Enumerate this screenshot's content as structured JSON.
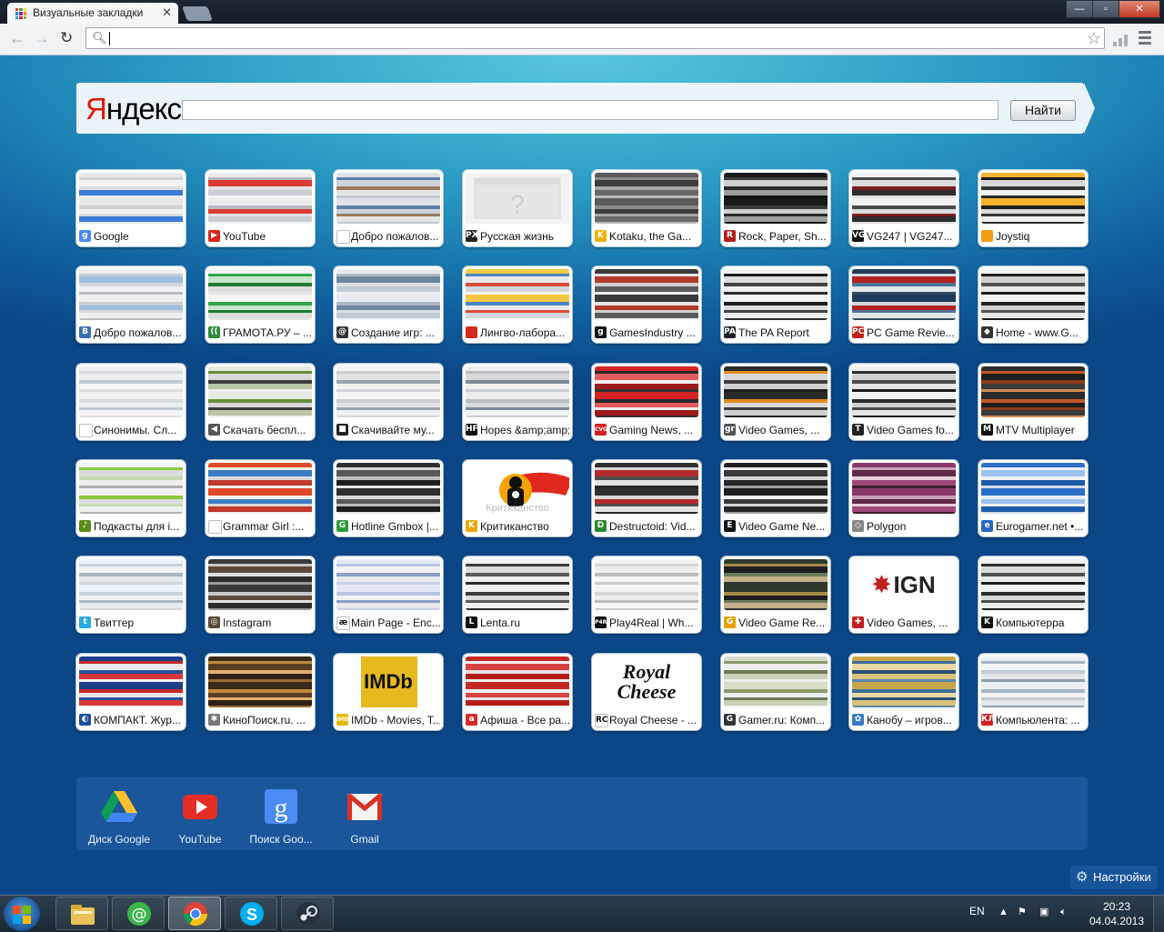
{
  "browser": {
    "tab_title": "Визуальные закладки",
    "tab_close": "✕",
    "window_controls": {
      "minimize": "—",
      "maximize": "▫",
      "close": "✕"
    },
    "address_value": ""
  },
  "yandex": {
    "logo_first": "Я",
    "logo_rest": "ндекс",
    "search_value": "",
    "search_button": "Найти"
  },
  "bookmarks": [
    {
      "label": "Google",
      "fav": "g",
      "fav_color": "#4a8af4",
      "stripes": [
        "#e8e8e8",
        "#cfd3d8",
        "#f2f2f2",
        "#dadde1",
        "#3a7bd5",
        "#e9ebee"
      ]
    },
    {
      "label": "YouTube",
      "fav": "▶",
      "fav_color": "#d8261d",
      "stripes": [
        "#ececec",
        "#b4b9bf",
        "#d93c34",
        "#e3e3e3",
        "#c9cdd2",
        "#f2f2f2"
      ]
    },
    {
      "label": "Добро пожалов...",
      "fav": "",
      "fav_color": "#ffffff",
      "stripes": [
        "#dfe3e7",
        "#5e7fa8",
        "#cdd3da",
        "#9a7a60",
        "#e5e5e5",
        "#c2c8cf"
      ]
    },
    {
      "label": "Русская жизнь",
      "fav": "РЖ",
      "fav_color": "#222222",
      "placeholder": true,
      "stripes": [
        "#f0f0f0",
        "#f0f0f0"
      ]
    },
    {
      "label": "Kotaku, the Ga...",
      "fav": "K",
      "fav_color": "#f0b400",
      "stripes": [
        "#5b5b5b",
        "#8a8a8a",
        "#3d3d3d",
        "#a5a5a5",
        "#696969",
        "#b8b8b8"
      ]
    },
    {
      "label": "Rock, Paper, Sh...",
      "fav": "R",
      "fav_color": "#b02020",
      "stripes": [
        "#1a1a1a",
        "#3b3b3b",
        "#d0d0d0",
        "#2a2a2a",
        "#9e9e9e",
        "#111111"
      ]
    },
    {
      "label": "VG247 | VG247...",
      "fav": "VG",
      "fav_color": "#111111",
      "stripes": [
        "#f1f1f1",
        "#4a4a4a",
        "#dcdcdc",
        "#7a2020",
        "#2d2d2d",
        "#e0e0e0"
      ]
    },
    {
      "label": "Joystiq",
      "fav": "",
      "fav_color": "#f39c12",
      "stripes": [
        "#f2b22d",
        "#1c1c1c",
        "#d9d9d9",
        "#333333",
        "#f0f0f0",
        "#2a2a2a"
      ]
    },
    {
      "label": "Добро пожалов...",
      "fav": "B",
      "fav_color": "#3b6fb0",
      "stripes": [
        "#eeeeee",
        "#c8cdd2",
        "#9cc0e0",
        "#d5d8dc",
        "#efefef",
        "#b7bcc2"
      ]
    },
    {
      "label": "ГРАМОТА.РУ – ...",
      "fav": "((",
      "fav_color": "#2d8a3a",
      "stripes": [
        "#f3f3f3",
        "#2fa449",
        "#c8e6c9",
        "#1f7a34",
        "#dcdcdc",
        "#e6e6e6"
      ]
    },
    {
      "label": "Создание игр: ...",
      "fav": "@",
      "fav_color": "#333333",
      "stripes": [
        "#e7ebef",
        "#aeb8c2",
        "#6f879e",
        "#d8dde2",
        "#c1cad3",
        "#eef0f2"
      ]
    },
    {
      "label": "Лингво-лабора...",
      "fav": "",
      "fav_color": "#d52b1e",
      "stripes": [
        "#f5c842",
        "#4a86c7",
        "#e9e9e9",
        "#d84a3a",
        "#cfd6dc",
        "#f3f3f3"
      ]
    },
    {
      "label": "GamesIndustry ...",
      "fav": "g",
      "fav_color": "#111111",
      "stripes": [
        "#3a3a3a",
        "#e5e5e5",
        "#b23a2a",
        "#cfcfcf",
        "#5a5a5a",
        "#efefef"
      ]
    },
    {
      "label": "The PA Report",
      "fav": "PA",
      "fav_color": "#222222",
      "stripes": [
        "#f2f2f2",
        "#1e1e1e",
        "#dcdcdc",
        "#444444",
        "#eeeeee",
        "#2b2b2b"
      ]
    },
    {
      "label": "PC Game Revie...",
      "fav": "PC",
      "fav_color": "#c0201a",
      "stripes": [
        "#1f3c5a",
        "#d3d9df",
        "#b42222",
        "#4e7399",
        "#e4e7ea",
        "#31485e"
      ]
    },
    {
      "label": "Home - www.G...",
      "fav": "◆",
      "fav_color": "#333333",
      "stripes": [
        "#f2f2f2",
        "#222222",
        "#cfcfcf",
        "#505050",
        "#e8e8e8",
        "#1a1a1a"
      ]
    },
    {
      "label": "Синонимы. Сл...",
      "fav": "",
      "fav_color": "#ffffff",
      "stripes": [
        "#f1f1f1",
        "#d6dbe0",
        "#eeeeee",
        "#c3cad1",
        "#f5f5f5",
        "#dedede"
      ]
    },
    {
      "label": "Скачать беспл...",
      "fav": "◀",
      "fav_color": "#555555",
      "stripes": [
        "#e6eadf",
        "#6b8c3a",
        "#d8d8d8",
        "#3c3c3c",
        "#b9c5a6",
        "#efefef"
      ]
    },
    {
      "label": "Скачивайте му...",
      "fav": "■",
      "fav_color": "#222222",
      "stripes": [
        "#f3f3f3",
        "#c9ced3",
        "#e2e2e2",
        "#9aa3ab",
        "#f0f0f0",
        "#d2d6da"
      ]
    },
    {
      "label": "Hopes &amp;amp; F...",
      "fav": "HF",
      "fav_color": "#111111",
      "stripes": [
        "#ececec",
        "#b8bec4",
        "#d9d9d9",
        "#7f8a95",
        "#f1f1f1",
        "#c9ced3"
      ]
    },
    {
      "label": "Gaming News, ...",
      "fav": "CVG",
      "fav_color": "#d81f1f",
      "stripes": [
        "#d42121",
        "#2a2a2a",
        "#e35b5b",
        "#f0f0f0",
        "#9e1a1a",
        "#333333"
      ]
    },
    {
      "label": "Video Games, ...",
      "fav": "gr",
      "fav_color": "#555555",
      "stripes": [
        "#2b2b2b",
        "#e08a1e",
        "#d8d8d8",
        "#3e3e3e",
        "#cfcfcf",
        "#1f1f1f"
      ]
    },
    {
      "label": "Video Games fo...",
      "fav": "T",
      "fav_color": "#222222",
      "stripes": [
        "#f2f2f2",
        "#2d2d2d",
        "#d0d0d0",
        "#4a4a4a",
        "#e4e4e4",
        "#1c1c1c"
      ]
    },
    {
      "label": "MTV Multiplayer",
      "fav": "M",
      "fav_color": "#111111",
      "stripes": [
        "#2a2a2a",
        "#c0562a",
        "#1e1e1e",
        "#8c3b1c",
        "#3b3b3b",
        "#d28b52"
      ]
    },
    {
      "label": "Подкасты для i...",
      "fav": "♪",
      "fav_color": "#5b8c1a",
      "stripes": [
        "#f2f2f2",
        "#8dc63f",
        "#dcdcdc",
        "#c9d8b3",
        "#efefef",
        "#b0b0b0"
      ]
    },
    {
      "label": "Grammar Girl :...",
      "fav": "",
      "fav_color": "#ffffff",
      "stripes": [
        "#e04a2a",
        "#f2f2f2",
        "#3c7cc4",
        "#d9d9d9",
        "#c0392b",
        "#efefef"
      ]
    },
    {
      "label": "Hotline Gmbox |...",
      "fav": "G",
      "fav_color": "#2f9a3a",
      "stripes": [
        "#2f2f2f",
        "#d8d8d8",
        "#585858",
        "#bcbcbc",
        "#1e1e1e",
        "#e6e6e6"
      ]
    },
    {
      "label": "Критиканство",
      "fav": "K",
      "fav_color": "#e8a800",
      "hero": "critic",
      "stripes": [
        "#ffffff",
        "#ffffff"
      ]
    },
    {
      "label": "Destructoid: Vid...",
      "fav": "D",
      "fav_color": "#2b8a2b",
      "stripes": [
        "#303030",
        "#d8d8d8",
        "#b22b2b",
        "#4d4d4d",
        "#e3e3e3",
        "#262626"
      ]
    },
    {
      "label": "Video Game Ne...",
      "fav": "E",
      "fav_color": "#111111",
      "stripes": [
        "#1f1f1f",
        "#f0f0f0",
        "#3a3a3a",
        "#d7d7d7",
        "#262626",
        "#9e9e9e"
      ]
    },
    {
      "label": "Polygon",
      "fav": "◇",
      "fav_color": "#888888",
      "stripes": [
        "#8a3a6a",
        "#c9a0b5",
        "#5e2a48",
        "#e7cfdb",
        "#a04a7a",
        "#3d1f30"
      ]
    },
    {
      "label": "Eurogamer.net •...",
      "fav": "e",
      "fav_color": "#2766c2",
      "stripes": [
        "#2a6fc9",
        "#e8eef6",
        "#9cc2ee",
        "#f1f1f1",
        "#1d5aa8",
        "#d3dde8"
      ]
    },
    {
      "label": "Твиттер",
      "fav": "t",
      "fav_color": "#2aa9e0",
      "stripes": [
        "#eaf3f8",
        "#c8d3db",
        "#f2f2f2",
        "#a9b6c0",
        "#e6ebee",
        "#d0d6db"
      ]
    },
    {
      "label": "Instagram",
      "fav": "◎",
      "fav_color": "#5a4a3a",
      "stripes": [
        "#3b3b3b",
        "#c7c7c7",
        "#5c4a3c",
        "#e1e1e1",
        "#2c2c2c",
        "#9a9a9a"
      ]
    },
    {
      "label": "Main Page - Enc...",
      "fav": "æ",
      "fav_color": "#ffffff",
      "fav_text_color": "#111111",
      "stripes": [
        "#e4e8f4",
        "#b9c4e0",
        "#f1f1f1",
        "#8d9ecb",
        "#e8e8e8",
        "#c9d0e5"
      ]
    },
    {
      "label": "Lenta.ru",
      "fav": "L",
      "fav_color": "#111111",
      "stripes": [
        "#f1f1f1",
        "#3a3a3a",
        "#dadada",
        "#595959",
        "#efefef",
        "#2b2b2b"
      ]
    },
    {
      "label": "Play4Real | Wh...",
      "fav": "P4R",
      "fav_color": "#111111",
      "stripes": [
        "#f3f3f3",
        "#d5d5d5",
        "#eeeeee",
        "#bdbdbd",
        "#f6f6f6",
        "#cacaca"
      ]
    },
    {
      "label": "Video Game Re...",
      "fav": "G",
      "fav_color": "#e6a100",
      "stripes": [
        "#2f3a2a",
        "#a58a4a",
        "#1e1e1e",
        "#6a7a5a",
        "#c2b08a",
        "#333333"
      ]
    },
    {
      "label": "Video Games, ...",
      "fav": "✚",
      "fav_color": "#c21f1f",
      "hero": "ign",
      "stripes": [
        "#ffffff",
        "#ffffff"
      ]
    },
    {
      "label": "Компьютерра",
      "fav": "K",
      "fav_color": "#111111",
      "stripes": [
        "#f0f0f0",
        "#2c2c2c",
        "#d9d9d9",
        "#4e4e4e",
        "#ececec",
        "#1c1c1c"
      ]
    },
    {
      "label": "КОМПАКТ. Жур...",
      "fav": "◐",
      "fav_color": "#1a4fa0",
      "stripes": [
        "#1f3e8c",
        "#c62828",
        "#e8e8e8",
        "#2a4f9e",
        "#d73737",
        "#f2f2f2"
      ]
    },
    {
      "label": "КиноПоиск.ru. ...",
      "fav": "✱",
      "fav_color": "#777777",
      "stripes": [
        "#3a2a1a",
        "#c08a3a",
        "#5a3e22",
        "#e0b070",
        "#2e2016",
        "#9a6a30"
      ]
    },
    {
      "label": "IMDb - Movies, T...",
      "fav": "IMDb",
      "fav_color": "#e5b800",
      "hero": "imdb",
      "stripes": [
        "#ffffff",
        "#ffffff"
      ]
    },
    {
      "label": "Афиша - Все ра...",
      "fav": "a",
      "fav_color": "#d42a2a",
      "stripes": [
        "#c62828",
        "#f2f2f2",
        "#d94343",
        "#e3e3e3",
        "#b71c1c",
        "#eeeeee"
      ]
    },
    {
      "label": "Royal Cheese - ...",
      "fav": "RC",
      "fav_color": "#ffffff",
      "fav_text_color": "#111111",
      "hero": "royal",
      "stripes": [
        "#ffffff",
        "#ffffff"
      ]
    },
    {
      "label": "Gamer.ru: Комп...",
      "fav": "G",
      "fav_color": "#333333",
      "stripes": [
        "#d8dcc8",
        "#8a9a6a",
        "#eeeeee",
        "#6b7a55",
        "#c9d0b6",
        "#f1f1f1"
      ]
    },
    {
      "label": "Канобу – игров...",
      "fav": "✿",
      "fav_color": "#3a7ac2",
      "stripes": [
        "#c9a64a",
        "#3c6e9c",
        "#e9d9a4",
        "#2a4e72",
        "#d8c17a",
        "#5a86ae"
      ]
    },
    {
      "label": "Компьюлента: ...",
      "fav": "КЛ",
      "fav_color": "#d42020",
      "stripes": [
        "#eceff3",
        "#a7b4c2",
        "#f3f3f3",
        "#c2cbd4",
        "#e4e7ea",
        "#8f9eac"
      ]
    }
  ],
  "hero_texts": {
    "critic": "Критиканство",
    "ign": "IGN",
    "imdb": "IMDb",
    "royal_line1": "Royal",
    "royal_line2": "Cheese"
  },
  "apps": [
    {
      "label": "Диск Google",
      "icon": "drive-icon"
    },
    {
      "label": "YouTube",
      "icon": "youtube-icon"
    },
    {
      "label": "Поиск Goo...",
      "icon": "google-search-icon"
    },
    {
      "label": "Gmail",
      "icon": "gmail-icon"
    }
  ],
  "settings_label": "Настройки",
  "taskbar": {
    "pinned": [
      "explorer-icon",
      "mail-agent-icon",
      "chrome-icon",
      "skype-icon",
      "steam-icon"
    ],
    "active": "chrome-icon",
    "language": "EN",
    "time": "20:23",
    "date": "04.04.2013"
  }
}
